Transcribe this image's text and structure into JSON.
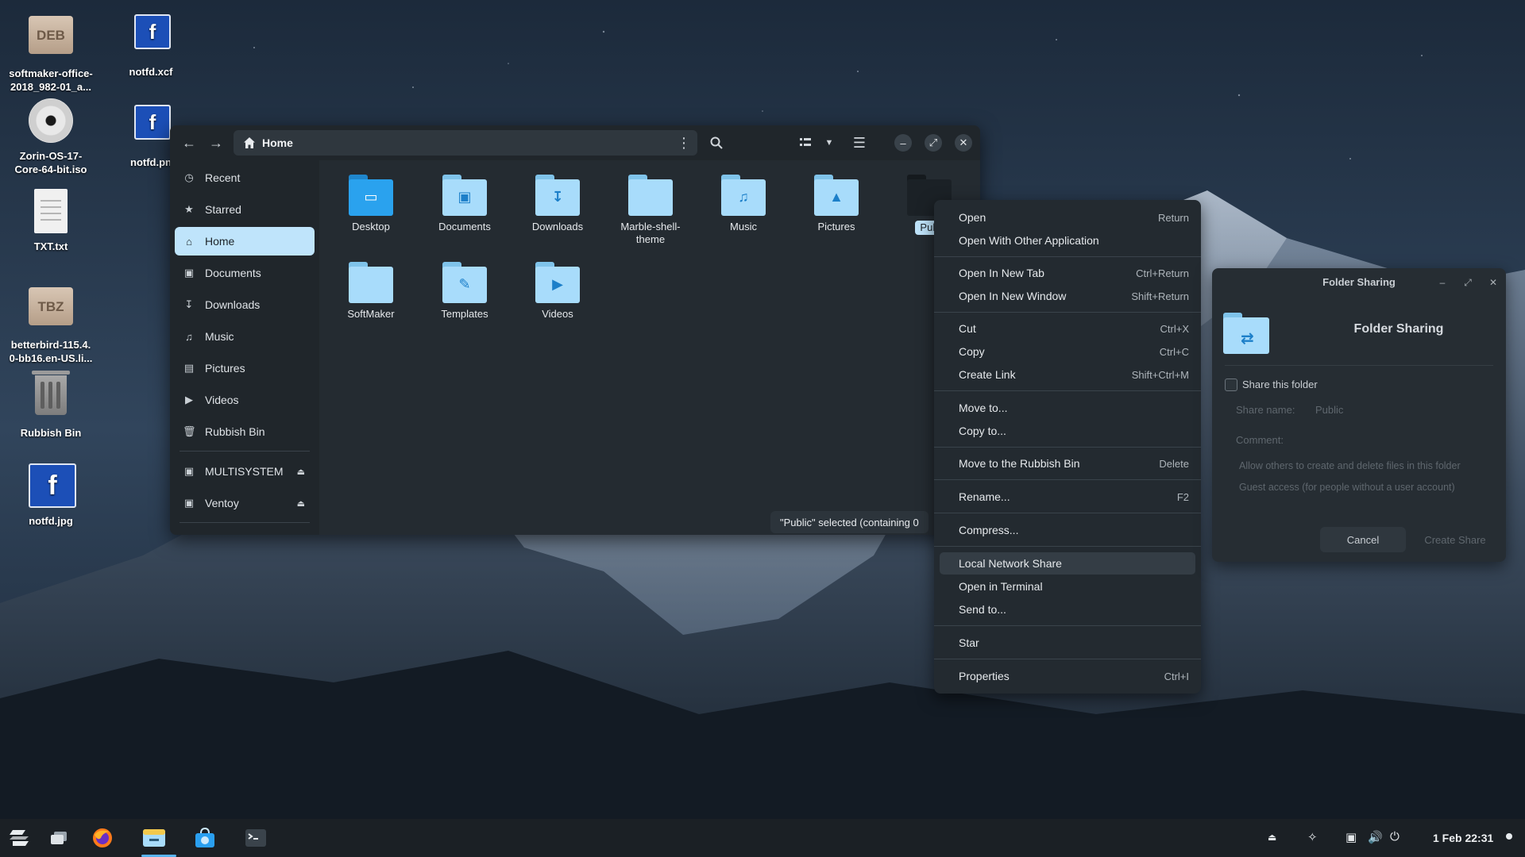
{
  "desktop": {
    "icons": [
      {
        "label": "softmaker-office-\n2018_982-01_a...",
        "kind": "DEB"
      },
      {
        "label": "notfd.xcf",
        "kind": "xcf"
      },
      {
        "label": "Zorin-OS-17-\nCore-64-bit.iso",
        "kind": "iso"
      },
      {
        "label": "notfd.pn",
        "kind": "png"
      },
      {
        "label": "TXT.txt",
        "kind": "txt"
      },
      {
        "label": "betterbird-115.4.\n0-bb16.en-US.li...",
        "kind": "TBZ"
      },
      {
        "label": "Rubbish Bin",
        "kind": "bin"
      },
      {
        "label": "notfd.jpg",
        "kind": "jpg"
      }
    ],
    "badges": {
      "deb": "DEB",
      "tbz": "TBZ",
      "fglyph": "f"
    }
  },
  "file_manager": {
    "path_label": "Home",
    "sidebar": [
      {
        "label": "Recent",
        "icon": "clock-icon"
      },
      {
        "label": "Starred",
        "icon": "star-icon"
      },
      {
        "label": "Home",
        "icon": "home-icon",
        "active": true
      },
      {
        "label": "Documents",
        "icon": "document-icon"
      },
      {
        "label": "Downloads",
        "icon": "download-icon"
      },
      {
        "label": "Music",
        "icon": "music-icon"
      },
      {
        "label": "Pictures",
        "icon": "picture-icon"
      },
      {
        "label": "Videos",
        "icon": "video-icon"
      },
      {
        "label": "Rubbish Bin",
        "icon": "trash-icon"
      },
      {
        "label": "MULTISYSTEM",
        "icon": "drive-icon",
        "eject": true
      },
      {
        "label": "Ventoy",
        "icon": "drive-icon",
        "eject": true
      }
    ],
    "files": [
      {
        "label": "Desktop",
        "icon": "desktop-folder-icon"
      },
      {
        "label": "Documents",
        "icon": "documents-folder-icon"
      },
      {
        "label": "Downloads",
        "icon": "downloads-folder-icon"
      },
      {
        "label": "Marble-shell-\ntheme",
        "icon": "folder-icon"
      },
      {
        "label": "Music",
        "icon": "music-folder-icon"
      },
      {
        "label": "Pictures",
        "icon": "pictures-folder-icon"
      },
      {
        "label": "Pub",
        "icon": "public-folder-icon",
        "selected": true
      },
      {
        "label": "SoftMaker",
        "icon": "folder-icon"
      },
      {
        "label": "Templates",
        "icon": "templates-folder-icon"
      },
      {
        "label": "Videos",
        "icon": "videos-folder-icon"
      }
    ],
    "status": "\"Public\" selected  (containing 0"
  },
  "context_menu": {
    "groups": [
      [
        {
          "label": "Open",
          "accel": "Return"
        },
        {
          "label": "Open With Other Application",
          "accel": ""
        }
      ],
      [
        {
          "label": "Open In New Tab",
          "accel": "Ctrl+Return"
        },
        {
          "label": "Open In New Window",
          "accel": "Shift+Return"
        }
      ],
      [
        {
          "label": "Cut",
          "accel": "Ctrl+X"
        },
        {
          "label": "Copy",
          "accel": "Ctrl+C"
        },
        {
          "label": "Create Link",
          "accel": "Shift+Ctrl+M"
        }
      ],
      [
        {
          "label": "Move to...",
          "accel": ""
        },
        {
          "label": "Copy to...",
          "accel": ""
        }
      ],
      [
        {
          "label": "Move to the Rubbish Bin",
          "accel": "Delete"
        }
      ],
      [
        {
          "label": "Rename...",
          "accel": "F2"
        }
      ],
      [
        {
          "label": "Compress...",
          "accel": ""
        }
      ],
      [
        {
          "label": "Local Network Share",
          "accel": "",
          "hover": true
        },
        {
          "label": "Open in Terminal",
          "accel": ""
        },
        {
          "label": "Send to...",
          "accel": ""
        }
      ],
      [
        {
          "label": "Star",
          "accel": ""
        }
      ],
      [
        {
          "label": "Properties",
          "accel": "Ctrl+I"
        }
      ]
    ]
  },
  "folder_sharing": {
    "window_title": "Folder Sharing",
    "heading": "Folder Sharing",
    "share_checkbox_label": "Share this folder",
    "share_name_label": "Share name:",
    "share_name_value": "Public",
    "comment_label": "Comment:",
    "allow_others_label": "Allow others to create and delete files in this folder",
    "guest_access_label": "Guest access (for people without a user account)",
    "cancel_label": "Cancel",
    "create_label": "Create Share"
  },
  "taskbar": {
    "clock": "1 Feb  22:31"
  },
  "colors": {
    "accent": "#59b4f0",
    "folder": "#a8dcfb",
    "sidebar_active": "#bfe4fb"
  }
}
